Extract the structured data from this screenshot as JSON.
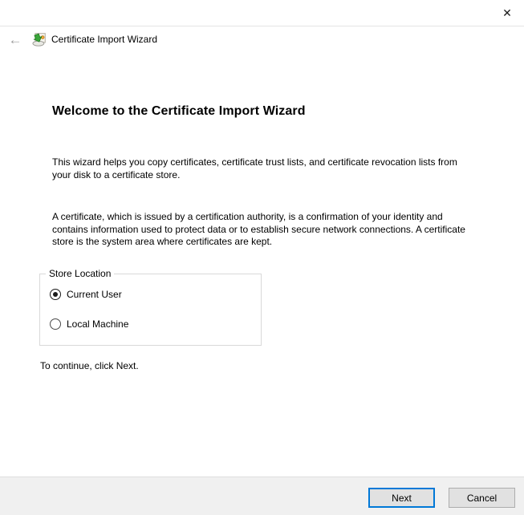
{
  "window": {
    "close_icon": "✕"
  },
  "header": {
    "back_icon": "←",
    "title": "Certificate Import Wizard"
  },
  "content": {
    "heading": "Welcome to the Certificate Import Wizard",
    "paragraph1": "This wizard helps you copy certificates, certificate trust lists, and certificate revocation lists from your disk to a certificate store.",
    "paragraph2": "A certificate, which is issued by a certification authority, is a confirmation of your identity and contains information used to protect data or to establish secure network connections. A certificate store is the system area where certificates are kept.",
    "store_location": {
      "label": "Store Location",
      "options": [
        {
          "label": "Current User",
          "selected": true
        },
        {
          "label": "Local Machine",
          "selected": false
        }
      ]
    },
    "hint": "To continue, click Next."
  },
  "footer": {
    "next_label": "Next",
    "cancel_label": "Cancel"
  },
  "colors": {
    "accent": "#0078d7",
    "button_face": "#e1e1e1",
    "footer_bg": "#f0f0f0",
    "divider": "#dfdfdf"
  }
}
